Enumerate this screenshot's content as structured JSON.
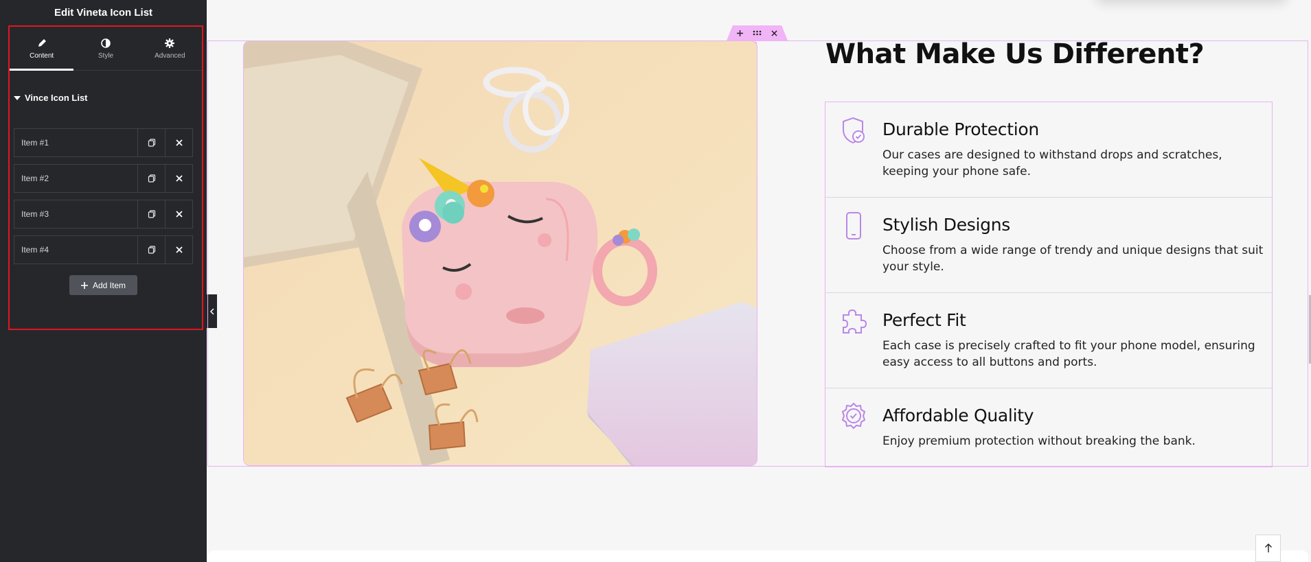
{
  "panel": {
    "title": "Edit Vineta Icon List",
    "tabs": [
      {
        "label": "Content",
        "icon": "pencil-icon",
        "active": true
      },
      {
        "label": "Style",
        "icon": "half-circle-icon",
        "active": false
      },
      {
        "label": "Advanced",
        "icon": "gear-icon",
        "active": false
      }
    ],
    "section_title": "Vince Icon List",
    "items": [
      "Item #1",
      "Item #2",
      "Item #3",
      "Item #4"
    ],
    "add_item_label": "Add Item"
  },
  "canvas": {
    "heading": "What Make Us Different?",
    "list": [
      {
        "icon": "shield-check-icon",
        "title": "Durable Protection",
        "desc": "Our cases are designed to withstand drops and scratches, keeping your phone safe."
      },
      {
        "icon": "smartphone-icon",
        "title": "Stylish Designs",
        "desc": "Choose from a wide range of trendy and unique designs that suit your style."
      },
      {
        "icon": "puzzle-icon",
        "title": "Perfect Fit",
        "desc": "Each case is precisely crafted to fit your phone model, ensuring easy access to all buttons and ports."
      },
      {
        "icon": "badge-check-icon",
        "title": "Affordable Quality",
        "desc": "Enjoy premium protection without breaking the bank."
      }
    ]
  },
  "colors": {
    "sidebar_bg": "#26272b",
    "accent_pink": "#f1b4f7",
    "icon_purple": "#b987e6",
    "focus_red": "#e2161d"
  }
}
